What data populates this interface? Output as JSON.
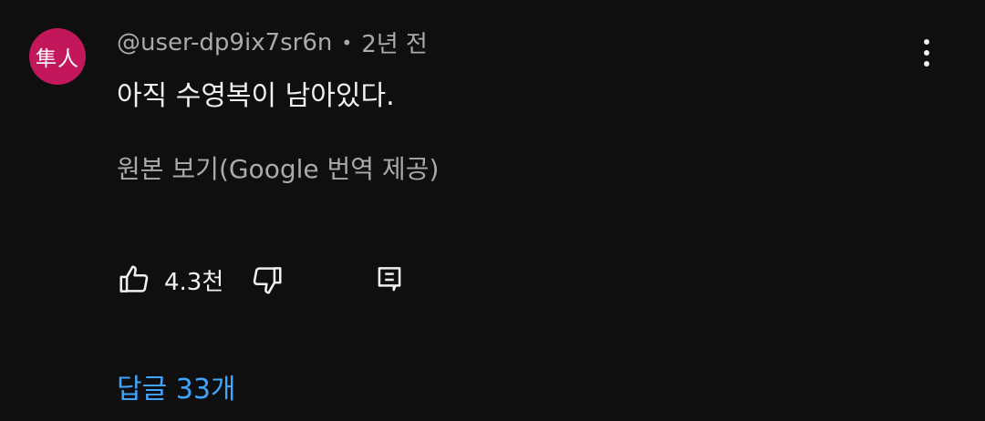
{
  "comment": {
    "avatar_text": "隼人",
    "avatar_color": "#c2185b",
    "author": "@user-dp9ix7sr6n",
    "separator": "•",
    "time": "2년 전",
    "text": "아직 수영복이 남아있다.",
    "translate_link": "원본 보기(Google 번역 제공)",
    "like_count": "4.3천",
    "replies_link": "답글 33개",
    "link_color": "#3ea6ff"
  },
  "icons": {
    "more": "more-vert-icon",
    "like": "thumbs-up-icon",
    "dislike": "thumbs-down-icon",
    "reply": "reply-icon"
  }
}
